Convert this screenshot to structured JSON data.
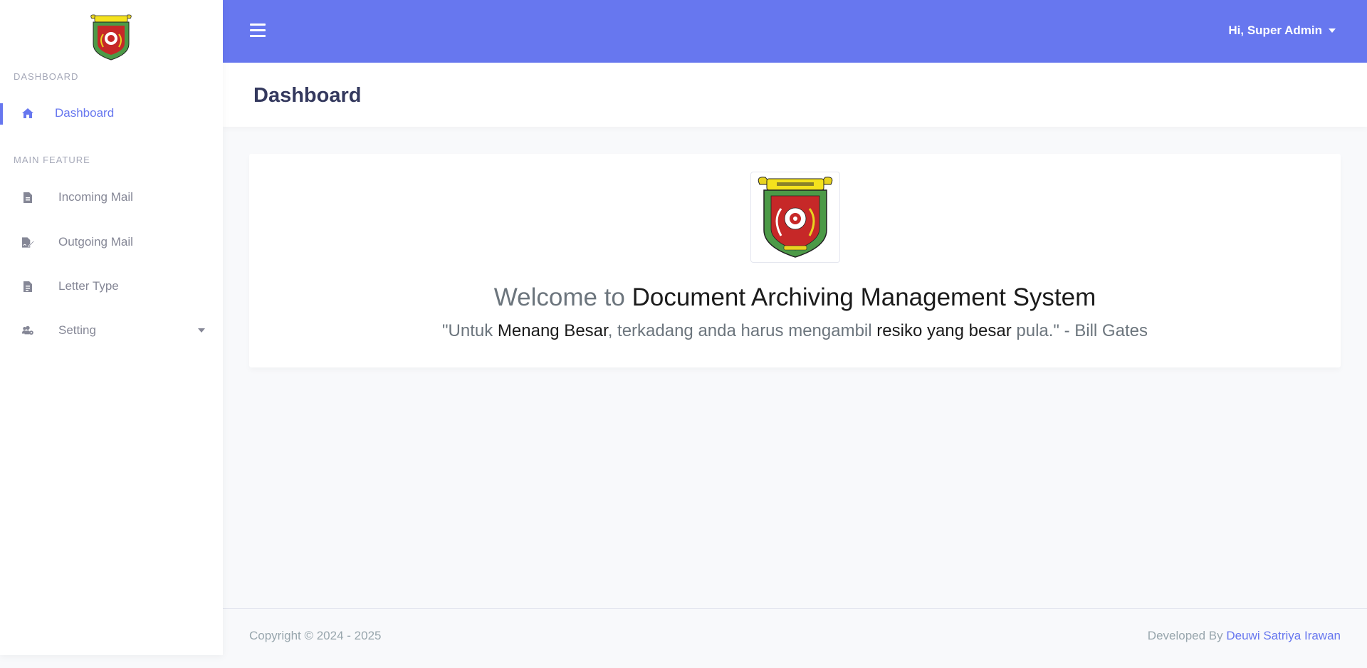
{
  "app": {
    "logo_icon": "kota-samarinda-emblem-icon"
  },
  "sidebar": {
    "sections": [
      {
        "heading": "DASHBOARD"
      },
      {
        "heading": "MAIN FEATURE"
      }
    ],
    "items": [
      {
        "label": "Dashboard",
        "icon": "home-icon",
        "active": true
      },
      {
        "label": "Incoming Mail",
        "icon": "file-icon"
      },
      {
        "label": "Outgoing Mail",
        "icon": "file-signature-icon"
      },
      {
        "label": "Letter Type",
        "icon": "file-alt-icon"
      },
      {
        "label": "Setting",
        "icon": "users-cog-icon",
        "has_dropdown": true
      }
    ]
  },
  "topbar": {
    "menu_icon": "hamburger-icon",
    "user_greeting": "Hi, Super Admin"
  },
  "page": {
    "title": "Dashboard"
  },
  "welcome": {
    "prefix": "Welcome to ",
    "system_name": "Document Archiving Management System",
    "quote_parts": [
      "\"Untuk ",
      "Menang Besar",
      ", terkadang anda harus mengambil ",
      "resiko yang besar",
      " pula.\" - Bill Gates"
    ]
  },
  "footer": {
    "copyright": "Copyright © 2024 - 2025",
    "developed_by_prefix": "Developed By ",
    "developer_name": "Deuwi Satriya Irawan"
  },
  "colors": {
    "primary": "#6777ef",
    "sidebar_bg": "#ffffff",
    "page_bg": "#f8f9fb",
    "heading": "#34395e"
  }
}
